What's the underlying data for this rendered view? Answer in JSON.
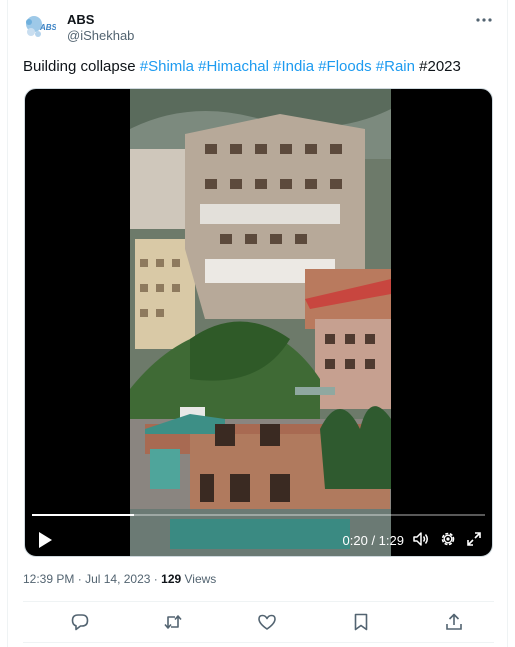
{
  "author": {
    "avatar_text": "ABS",
    "name": "ABS",
    "handle": "@iShekhab"
  },
  "tweet": {
    "text_prefix": "Building collapse ",
    "hashtags": [
      "#Shimla",
      "#Himachal",
      "#India",
      "#Floods",
      "#Rain"
    ],
    "trailing_text": "#2023"
  },
  "video": {
    "time_display": "0:20 / 1:29",
    "progress_fraction": 0.2247
  },
  "meta": {
    "time": "12:39 PM",
    "separator": "·",
    "date": "Jul 14, 2023",
    "views_count": "129",
    "views_label": "Views"
  },
  "colors": {
    "link": "#1d9bf0",
    "secondary_text": "#536471",
    "divider": "#eff3f4"
  },
  "icons": [
    "more-icon",
    "play-icon",
    "volume-icon",
    "settings-icon",
    "fullscreen-icon",
    "reply-icon",
    "retweet-icon",
    "like-icon",
    "bookmark-icon",
    "share-icon"
  ]
}
